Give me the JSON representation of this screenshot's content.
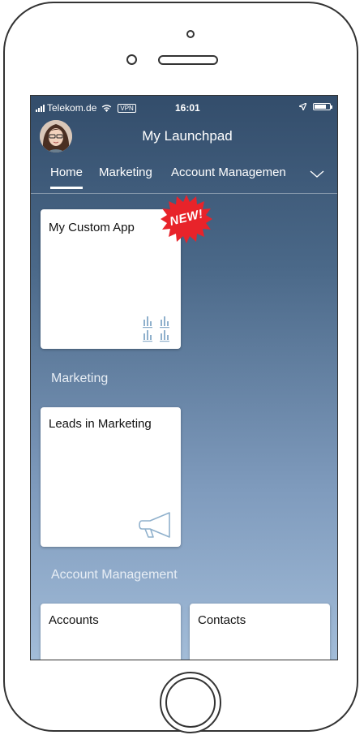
{
  "status_bar": {
    "carrier": "Telekom.de",
    "vpn": "VPN",
    "time": "16:01"
  },
  "header": {
    "title": "My Launchpad"
  },
  "tabs": [
    {
      "label": "Home",
      "selected": true
    },
    {
      "label": "Marketing",
      "selected": false
    },
    {
      "label": "Account Managemen",
      "selected": false
    }
  ],
  "home": {
    "tiles": [
      {
        "title": "My Custom App",
        "badge": "NEW!",
        "icon": "bar-chart-grid-icon"
      }
    ]
  },
  "marketing": {
    "section_title": "Marketing",
    "tiles": [
      {
        "title": "Leads in Marketing",
        "icon": "megaphone-icon"
      }
    ]
  },
  "account_management": {
    "section_title": "Account Management",
    "tiles": [
      {
        "title": "Accounts"
      },
      {
        "title": "Contacts"
      }
    ]
  },
  "colors": {
    "accent_new": "#e8232a",
    "icon_blue": "#8fb0cc",
    "background_top": "#334d6b",
    "background_bottom": "#a2bcd8"
  }
}
